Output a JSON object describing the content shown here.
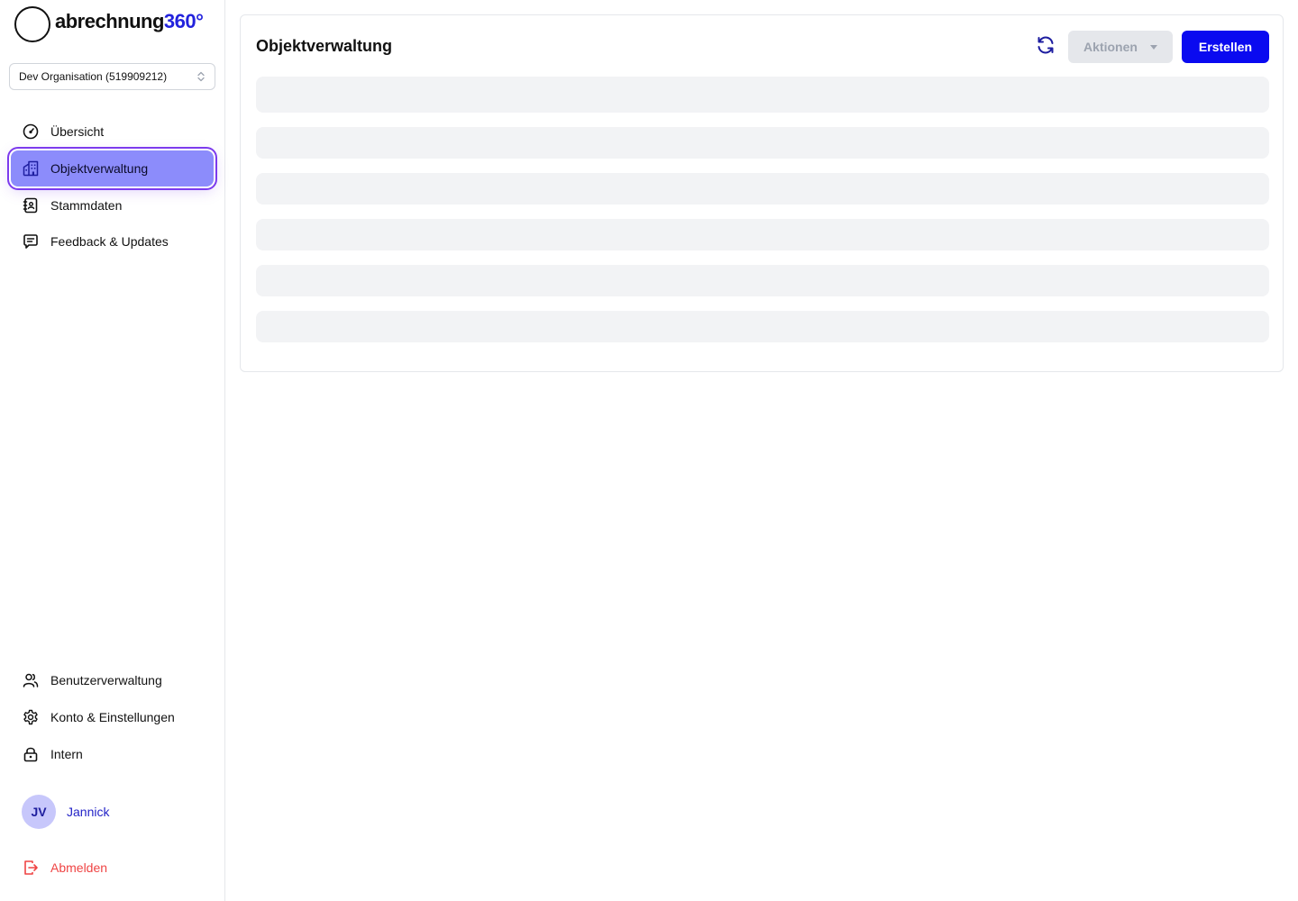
{
  "brand": {
    "name_main": "abrechnung",
    "name_accent": "360°",
    "accent_color": "#2222dd"
  },
  "org_selector": {
    "value": "Dev Organisation (519909212)"
  },
  "nav": {
    "top_items": [
      {
        "label": "Übersicht",
        "icon": "gauge-icon",
        "active": false
      },
      {
        "label": "Objektverwaltung",
        "icon": "buildings-icon",
        "active": true
      },
      {
        "label": "Stammdaten",
        "icon": "address-book-icon",
        "active": false
      },
      {
        "label": "Feedback & Updates",
        "icon": "message-icon",
        "active": false
      }
    ],
    "bottom_items": [
      {
        "label": "Benutzerverwaltung",
        "icon": "users-icon"
      },
      {
        "label": "Konto & Einstellungen",
        "icon": "gear-icon"
      },
      {
        "label": "Intern",
        "icon": "lock-icon"
      }
    ]
  },
  "user": {
    "initials": "JV",
    "name": "Jannick"
  },
  "logout": {
    "label": "Abmelden"
  },
  "main": {
    "title": "Objektverwaltung",
    "actions_label": "Aktionen",
    "create_label": "Erstellen"
  },
  "colors": {
    "primary": "#0a0af0",
    "active_nav": "#8c8cfb",
    "danger": "#ef4444",
    "skeleton": "#f2f3f5"
  }
}
